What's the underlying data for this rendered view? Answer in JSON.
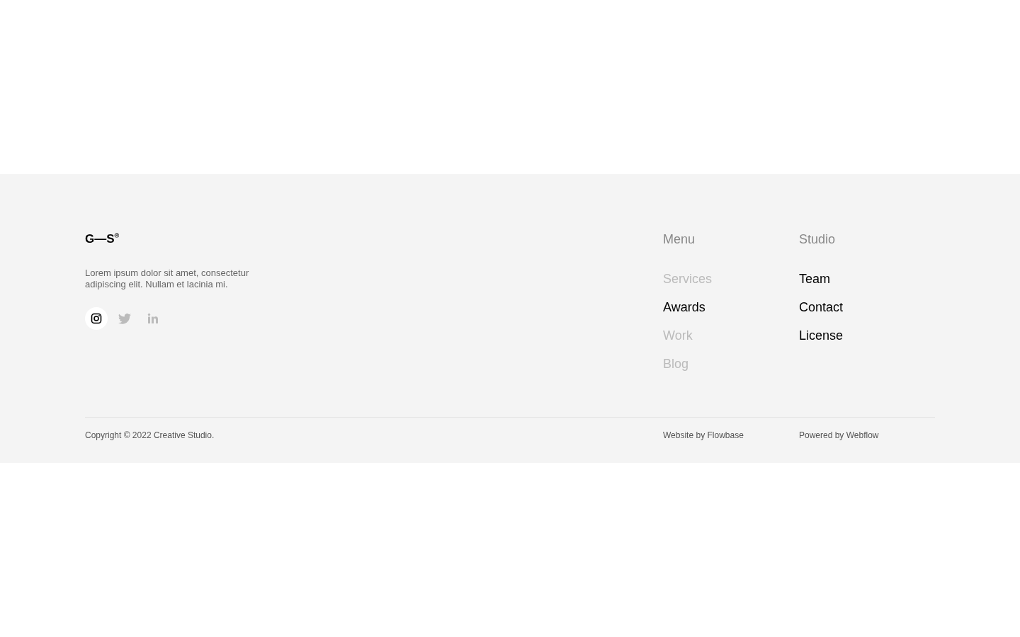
{
  "logo": {
    "text": "G—S",
    "mark": "®"
  },
  "description": "Lorem ipsum dolor sit amet, consectetur adipiscing elit. Nullam et lacinia mi.",
  "socials": [
    {
      "kind": "instagram",
      "active": true
    },
    {
      "kind": "twitter",
      "active": false
    },
    {
      "kind": "linkedin",
      "active": false
    }
  ],
  "columns": [
    {
      "title": "Menu",
      "links": [
        {
          "label": "Services",
          "active": false
        },
        {
          "label": "Awards",
          "active": true
        },
        {
          "label": "Work",
          "active": false
        },
        {
          "label": "Blog",
          "active": false
        }
      ]
    },
    {
      "title": "Studio",
      "links": [
        {
          "label": "Team",
          "active": true
        },
        {
          "label": "Contact",
          "active": true
        },
        {
          "label": "License",
          "active": true
        }
      ]
    }
  ],
  "bottom": {
    "copyright": "Copyright © 2022 Creative Studio.",
    "credits": [
      "Website by Flowbase",
      "Powered by Webflow"
    ]
  }
}
